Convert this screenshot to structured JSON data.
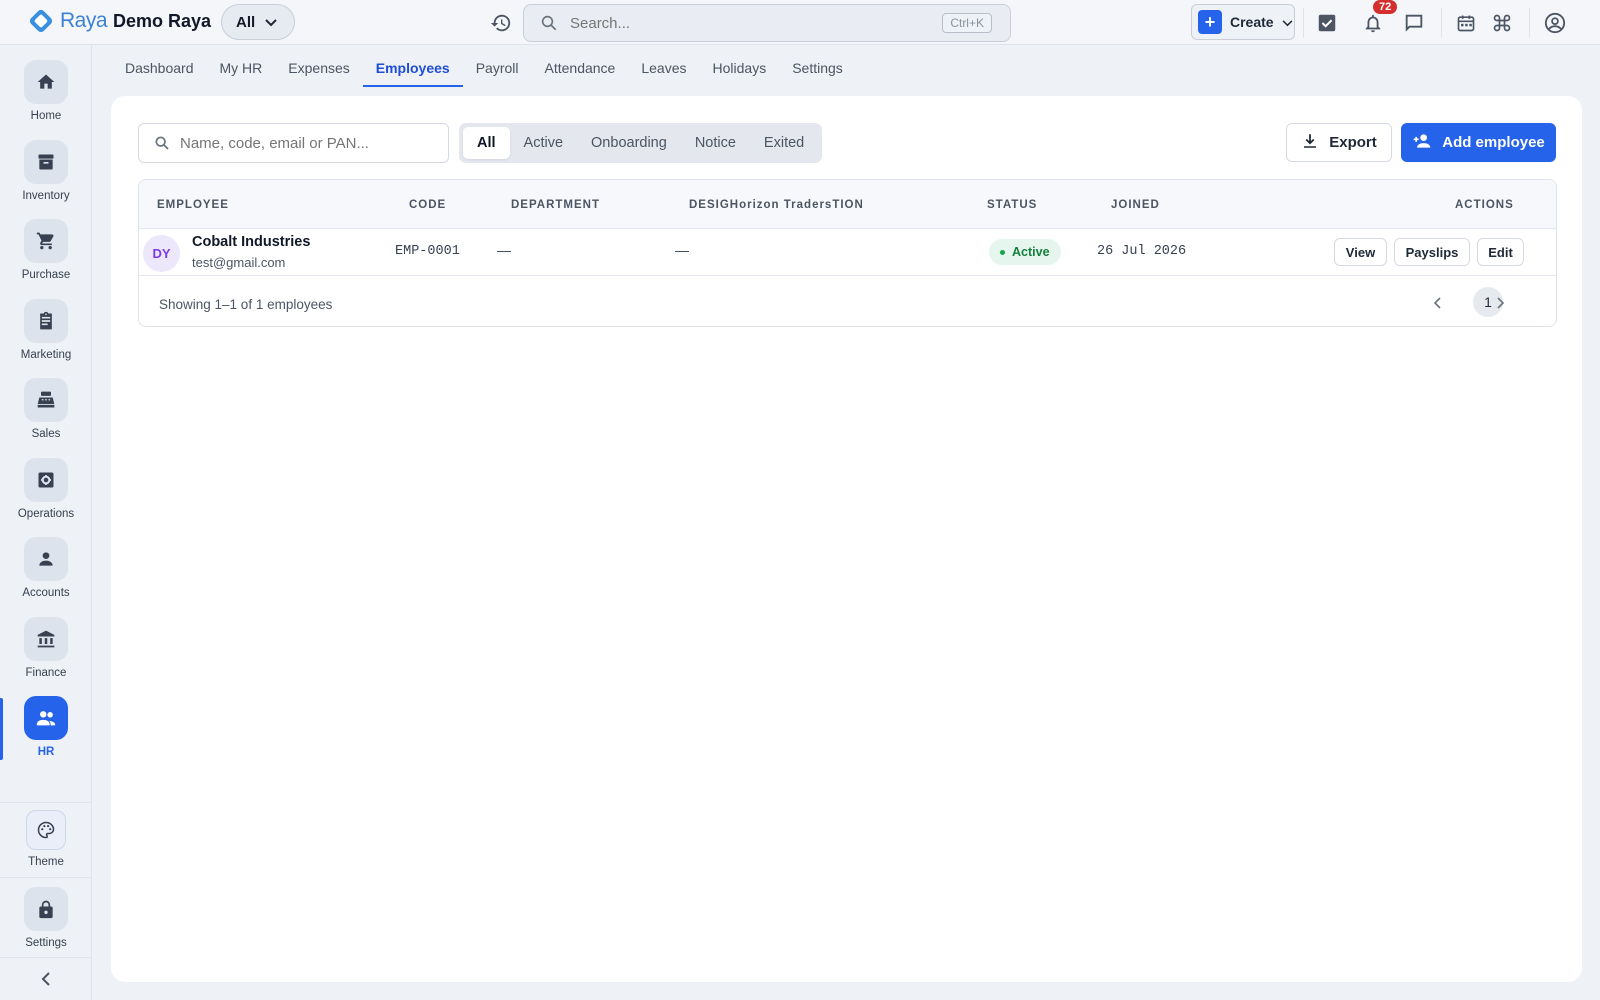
{
  "app": {
    "logo_text": "Raya",
    "org_name": "Demo Raya",
    "scope_selector": "All",
    "search_placeholder": "Search...",
    "search_shortcut": "Ctrl+K",
    "create_label": "Create",
    "notification_count": "72"
  },
  "sidebar": {
    "items": [
      {
        "label": "Home",
        "icon": "home-icon"
      },
      {
        "label": "Inventory",
        "icon": "archive-icon"
      },
      {
        "label": "Purchase",
        "icon": "cart-icon"
      },
      {
        "label": "Marketing",
        "icon": "clipboard-icon"
      },
      {
        "label": "Sales",
        "icon": "register-icon"
      },
      {
        "label": "Operations",
        "icon": "gear-box-icon"
      },
      {
        "label": "Accounts",
        "icon": "person-icon"
      },
      {
        "label": "Finance",
        "icon": "bank-icon"
      },
      {
        "label": "HR",
        "icon": "people-icon",
        "active": true
      }
    ],
    "bottom": [
      {
        "label": "Theme",
        "icon": "palette-icon"
      },
      {
        "label": "Settings",
        "icon": "lock-icon"
      }
    ]
  },
  "tabs": [
    "Dashboard",
    "My HR",
    "Expenses",
    "Employees",
    "Payroll",
    "Attendance",
    "Leaves",
    "Holidays",
    "Settings"
  ],
  "active_tab": "Employees",
  "filters": {
    "search_placeholder": "Name, code, email or PAN...",
    "segments": [
      "All",
      "Active",
      "Onboarding",
      "Notice",
      "Exited"
    ],
    "active_segment": "All"
  },
  "actions": {
    "export": "Export",
    "add_employee": "Add employee"
  },
  "table": {
    "columns": [
      "EMPLOYEE",
      "CODE",
      "DEPARTMENT",
      "DESIGHorizon TradersTION",
      "STATUS",
      "JOINED",
      "ACTIONS"
    ],
    "rows": [
      {
        "initials": "DY",
        "name": "Cobalt Industries",
        "email": "test@gmail.com",
        "code": "EMP-0001",
        "department": "—",
        "designation": "—",
        "status": "Active",
        "joined": "26 Jul 2026",
        "actions": [
          "View",
          "Payslips",
          "Edit"
        ]
      }
    ],
    "footer": "Showing 1–1 of 1 employees",
    "current_page": "1"
  },
  "colors": {
    "primary": "#2563eb",
    "status_active": "#15803d",
    "notification": "#d32f2f"
  }
}
